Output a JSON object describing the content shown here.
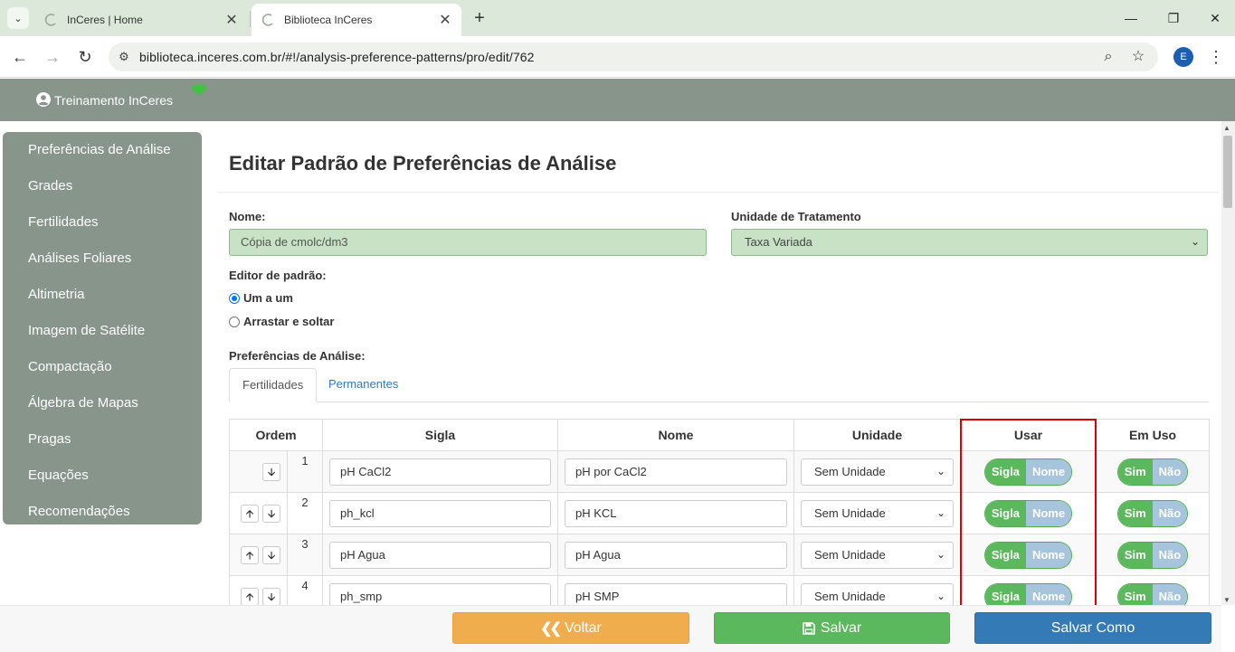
{
  "browser": {
    "tabs": [
      {
        "title": "InCeres | Home",
        "active": false
      },
      {
        "title": "Biblioteca InCeres",
        "active": true
      }
    ],
    "url": "biblioteca.inceres.com.br/#!/analysis-preference-patterns/pro/edit/762",
    "profile_initial": "E"
  },
  "header": {
    "user_name": "Treinamento InCeres"
  },
  "sidebar": {
    "items": [
      "Preferências de Análise",
      "Grades",
      "Fertilidades",
      "Análises Foliares",
      "Altimetria",
      "Imagem de Satélite",
      "Compactação",
      "Álgebra de Mapas",
      "Pragas",
      "Equações",
      "Recomendações"
    ]
  },
  "page": {
    "title": "Editar Padrão de Preferências de Análise",
    "name_label": "Nome:",
    "name_value": "Cópia de cmolc/dm3",
    "unit_label": "Unidade de Tratamento",
    "unit_value": "Taxa Variada",
    "editor_label": "Editor de padrão:",
    "editor_options": [
      "Um a um",
      "Arrastar e soltar"
    ],
    "prefs_label": "Preferências de Análise:",
    "tabs": [
      "Fertilidades",
      "Permanentes"
    ]
  },
  "table": {
    "headers": [
      "Ordem",
      "Sigla",
      "Nome",
      "Unidade",
      "Usar",
      "Em Uso"
    ],
    "toggle_usar": {
      "on": "Sigla",
      "off": "Nome"
    },
    "toggle_emuso": {
      "on": "Sim",
      "off": "Não"
    },
    "rows": [
      {
        "order": "1",
        "sigla": "pH CaCl2",
        "nome": "pH por CaCl2",
        "unidade": "Sem Unidade"
      },
      {
        "order": "2",
        "sigla": "ph_kcl",
        "nome": "pH KCL",
        "unidade": "Sem Unidade"
      },
      {
        "order": "3",
        "sigla": "pH Agua",
        "nome": "pH Agua",
        "unidade": "Sem Unidade"
      },
      {
        "order": "4",
        "sigla": "ph_smp",
        "nome": "pH SMP",
        "unidade": "Sem Unidade"
      }
    ]
  },
  "footer": {
    "back": "Voltar",
    "save": "Salvar",
    "save_as": "Salvar Como"
  }
}
